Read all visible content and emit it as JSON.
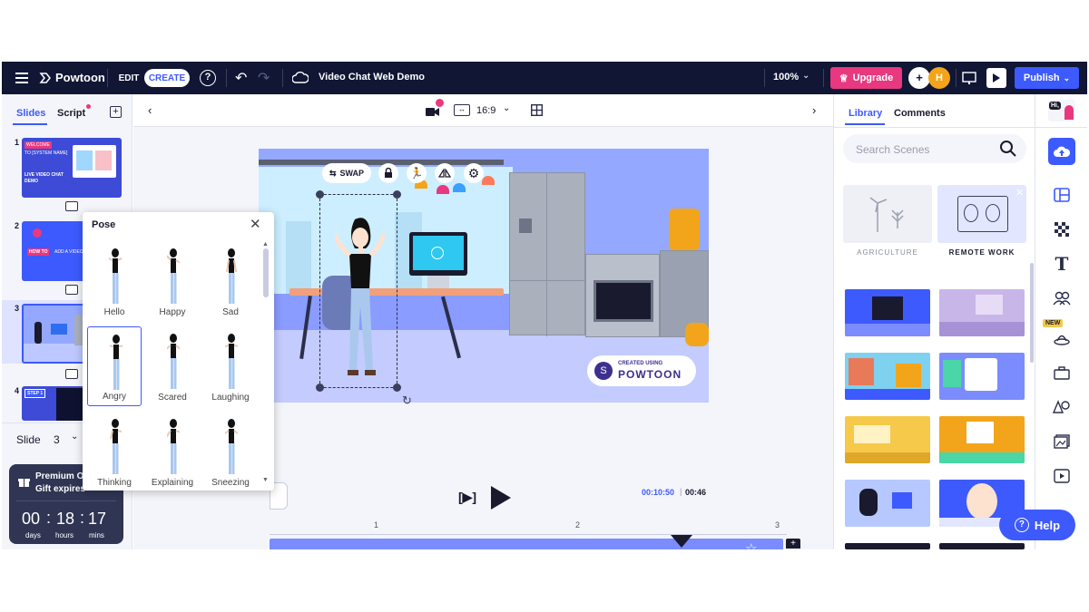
{
  "topbar": {
    "logo": "Powtoon",
    "edit_label": "EDIT",
    "create_label": "CREATE",
    "project_title": "Video Chat Web Demo",
    "zoom": "100%",
    "upgrade_label": "Upgrade",
    "avatar_initial": "H",
    "publish_label": "Publish"
  },
  "left": {
    "tabs": [
      "Slides",
      "Script"
    ],
    "slides": [
      {
        "num": "1",
        "title1": "WELCOME",
        "title2": "TO [SYSTEM NAME]",
        "title3": "LIVE VIDEO CHAT",
        "title4": "DEMO"
      },
      {
        "num": "2",
        "badge": "HOW TO",
        "text": "ADD A VIDEO"
      },
      {
        "num": "3"
      },
      {
        "num": "4",
        "badge": "STEP 1"
      }
    ],
    "slide_label": "Slide",
    "slide_value": "3",
    "promo_title_1": "Premium O",
    "promo_title_2": "Gift expires",
    "countdown": {
      "days": "00",
      "hours": "18",
      "mins": "17",
      "days_label": "days",
      "hours_label": "hours",
      "mins_label": "mins"
    }
  },
  "canvas": {
    "ratio": "16:9",
    "swap_label": "SWAP",
    "watermark_top": "CREATED USING",
    "watermark_brand": "POWTOON",
    "time_current": "00:10:50",
    "time_total": "00:46",
    "ruler": [
      "1",
      "2",
      "3"
    ]
  },
  "pose": {
    "title": "Pose",
    "items": [
      "Hello",
      "Happy",
      "Sad",
      "Angry",
      "Scared",
      "Laughing",
      "Thinking",
      "Explaining",
      "Sneezing"
    ],
    "selected": "Angry"
  },
  "right": {
    "tabs": [
      "Library",
      "Comments"
    ],
    "search_placeholder": "Search Scenes",
    "categories": [
      "AGRICULTURE",
      "REMOTE WORK"
    ],
    "help_label": "Help",
    "new_badge": "NEW",
    "hi_label": "Hi,"
  },
  "colors": {
    "topbar": "#101634",
    "accent": "#3d5afe",
    "upgrade": "#e8387f",
    "stage": "#94a8ff"
  }
}
